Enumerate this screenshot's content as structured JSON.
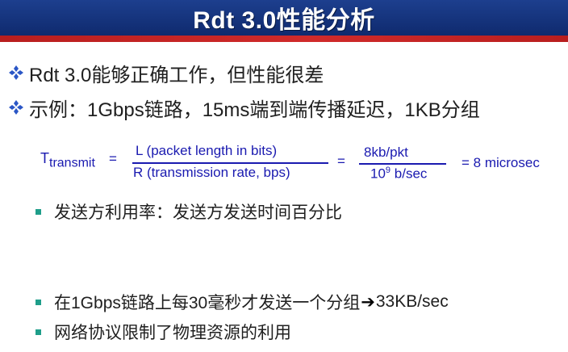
{
  "title": "Rdt 3.0性能分析",
  "bullets": [
    "Rdt 3.0能够正确工作，但性能很差",
    "示例：1Gbps链路，15ms端到端传播延迟，1KB分组"
  ],
  "formula": {
    "lhs_main": "T",
    "lhs_sub": "transmit",
    "eq": "=",
    "num1": "L (packet length in bits)",
    "den1": "R (transmission rate, bps)",
    "num2": "8kb/pkt",
    "den2_base": "10",
    "den2_exp": "9",
    "den2_unit": " b/sec",
    "result": "= 8 microsec"
  },
  "sub_bullets": {
    "utilization": "发送方利用率：发送方发送时间百分比",
    "every30ms_before": "在1Gbps链路上每30毫秒才发送一个分组",
    "arrow": "➔",
    "every30ms_after": "33KB/sec",
    "limit": "网络协议限制了物理资源的利用"
  },
  "colors": {
    "title_bg": "#1d3f8e",
    "title_stripe": "#b81e1e",
    "formula_text": "#1a1ab0",
    "sub_bullet_square": "#1f9e8a",
    "diamond": "#2a56c6"
  },
  "icons": {
    "bullet1": "diamond-bullet-icon",
    "bullet2": "square-bullet-icon"
  }
}
